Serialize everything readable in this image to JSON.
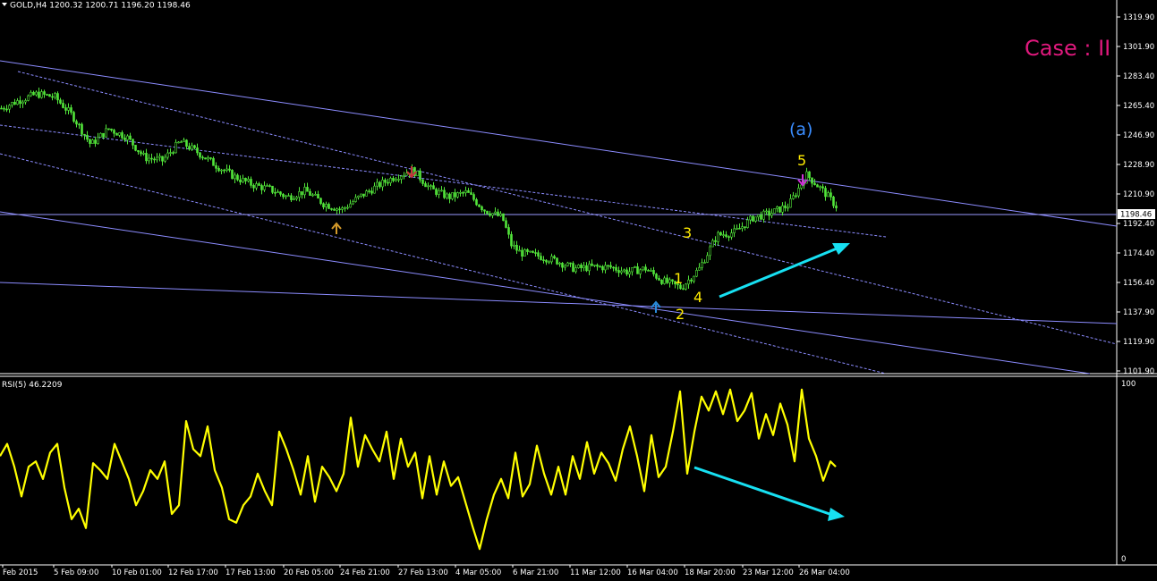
{
  "header": {
    "symbol_info": "GOLD,H4  1200.32 1200.71 1196.20 1198.46",
    "case_label": "Case : II"
  },
  "price_panel": {
    "y_ticks": [
      "1319.90",
      "1301.90",
      "1283.40",
      "1265.40",
      "1246.90",
      "1228.90",
      "1210.90",
      "1192.40",
      "1174.40",
      "1156.40",
      "1137.90",
      "1119.90",
      "1101.90"
    ],
    "current_price": "1198.46",
    "wave_labels": {
      "w1": "1",
      "w2": "2",
      "w3": "3",
      "w4": "4",
      "w5": "5",
      "wa": "(a)"
    }
  },
  "rsi_panel": {
    "title": "RSI(5) 46.2209",
    "y_max_label": "100",
    "y_min_label": "0"
  },
  "x_axis": {
    "labels": [
      "Feb 2015",
      "5 Feb 09:00",
      "10 Feb 01:00",
      "12 Feb 17:00",
      "17 Feb 13:00",
      "20 Feb 05:00",
      "24 Feb 21:00",
      "27 Feb 13:00",
      "4 Mar 05:00",
      "6 Mar 21:00",
      "11 Mar 12:00",
      "16 Mar 04:00",
      "18 Mar 20:00",
      "23 Mar 12:00",
      "26 Mar 04:00"
    ]
  },
  "chart_data": [
    {
      "type": "line",
      "series": [
        {
          "x": [
            0,
            20,
            40,
            60,
            80,
            100,
            120,
            140,
            160,
            180,
            200,
            220,
            240,
            260,
            280,
            300,
            320,
            340,
            360,
            380,
            400,
            420,
            440,
            460,
            480,
            500,
            520,
            540,
            560,
            570,
            580,
            600,
            620,
            640,
            660,
            680,
            700,
            720,
            740,
            760,
            780,
            800,
            820,
            840,
            860,
            880,
            900,
            920,
            935
          ],
          "values": [
            1261,
            1266,
            1270,
            1268,
            1256,
            1238,
            1248,
            1243,
            1230,
            1228,
            1240,
            1233,
            1225,
            1218,
            1213,
            1210,
            1205,
            1209,
            1201,
            1197,
            1205,
            1212,
            1218,
            1222,
            1210,
            1205,
            1208,
            1197,
            1192,
            1175,
            1170,
            1168,
            1165,
            1160,
            1161,
            1161,
            1158,
            1160,
            1152,
            1148,
            1160,
            1181,
            1183,
            1192,
            1195,
            1200,
            1219,
            1208,
            1198
          ]
        }
      ],
      "ylim": [
        1095,
        1328
      ]
    },
    {
      "type": "line",
      "series": [
        {
          "x": [
            0,
            8,
            16,
            24,
            32,
            40,
            48,
            56,
            64,
            72,
            80,
            88,
            96,
            104,
            112,
            120,
            128,
            136,
            144,
            152,
            160,
            168,
            176,
            184,
            192,
            200,
            208,
            216,
            224,
            232,
            240,
            248,
            256,
            264,
            272,
            280,
            288,
            296,
            304,
            312,
            320,
            328,
            336,
            344,
            352,
            360,
            368,
            376,
            384,
            392,
            400,
            408,
            416,
            424,
            432,
            440,
            448,
            456,
            464,
            472,
            480,
            488,
            496,
            504,
            512,
            520,
            528,
            536,
            544,
            552,
            560,
            568,
            576,
            584,
            592,
            600,
            608,
            616,
            624,
            632,
            640,
            648,
            656,
            664,
            672,
            680,
            688,
            696,
            704,
            712,
            720,
            728,
            736,
            744,
            752,
            760,
            768,
            776,
            784,
            792,
            800,
            808,
            816,
            824,
            832,
            840,
            848,
            856,
            864,
            872,
            880,
            888,
            896,
            904,
            912,
            920,
            928,
            934
          ],
          "values": [
            58,
            65,
            52,
            35,
            52,
            55,
            45,
            60,
            65,
            40,
            22,
            28,
            17,
            54,
            50,
            45,
            65,
            55,
            45,
            30,
            38,
            50,
            45,
            55,
            25,
            30,
            78,
            62,
            58,
            75,
            50,
            40,
            22,
            20,
            30,
            35,
            48,
            38,
            30,
            72,
            62,
            50,
            36,
            58,
            32,
            52,
            46,
            38,
            48,
            80,
            52,
            70,
            62,
            55,
            72,
            45,
            68,
            52,
            60,
            34,
            58,
            36,
            55,
            41,
            46,
            32,
            18,
            5,
            22,
            36,
            45,
            34,
            60,
            35,
            42,
            64,
            48,
            36,
            52,
            36,
            58,
            45,
            66,
            48,
            60,
            54,
            44,
            62,
            75,
            58,
            38,
            70,
            46,
            52,
            72,
            95,
            48,
            72,
            92,
            84,
            95,
            82,
            96,
            78,
            84,
            94,
            68,
            82,
            70,
            88,
            76,
            55,
            96,
            68,
            58,
            44,
            55,
            52
          ]
        }
      ],
      "ylim": [
        0,
        100
      ]
    }
  ],
  "colors": {
    "candle": "#52e53a",
    "channel": "#8c8cff",
    "rsi": "#ffff00",
    "arrow": "#17e0f2",
    "wave_numbers": "#ffeb00",
    "wave_a": "#3a8dff",
    "case": "#e0197d"
  }
}
